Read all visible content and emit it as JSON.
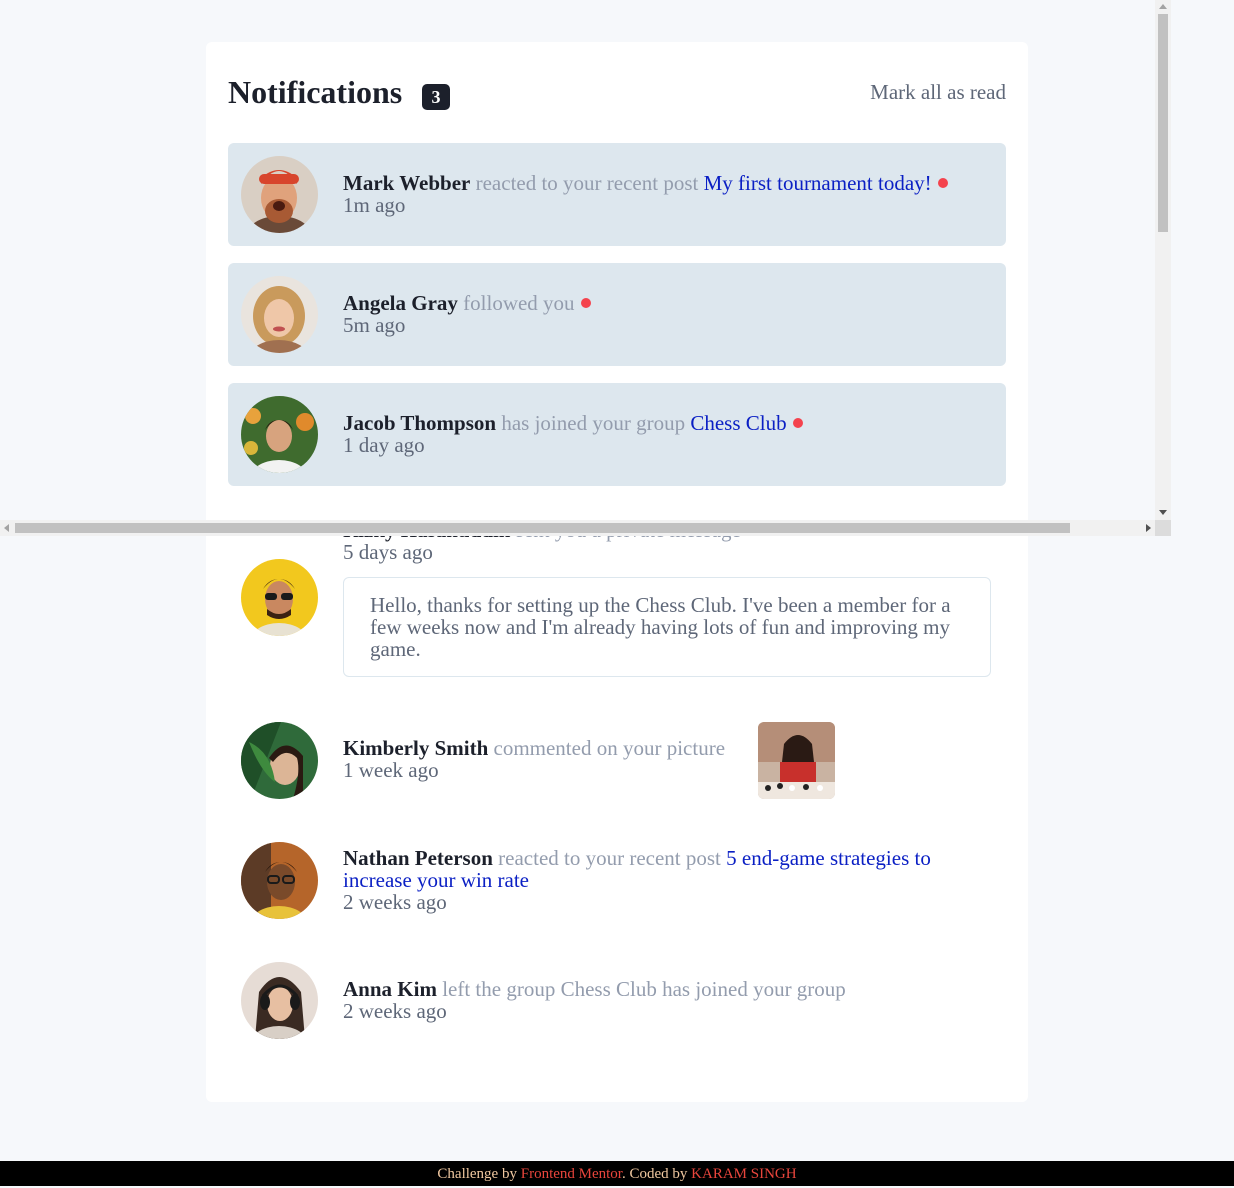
{
  "header": {
    "title": "Notifications",
    "unread_count": "3",
    "mark_all_label": "Mark all as read"
  },
  "notifications": [
    {
      "name": "Mark Webber",
      "action": "reacted to your recent post",
      "target": "My first tournament today!",
      "time": "1m ago",
      "unread": true
    },
    {
      "name": "Angela Gray",
      "action": "followed you",
      "target": "",
      "time": "5m ago",
      "unread": true
    },
    {
      "name": "Jacob Thompson",
      "action": "has joined your group",
      "target": "Chess Club",
      "time": "1 day ago",
      "unread": true
    },
    {
      "name": "Rizky Hasanuddin",
      "action": "sent you a private message",
      "target": "",
      "time": "5 days ago",
      "unread": false,
      "message": "Hello, thanks for setting up the Chess Club. I've been a member for a few weeks now and I'm already having lots of fun and improving my game."
    },
    {
      "name": "Kimberly Smith",
      "action": "commented on your picture",
      "target": "",
      "time": "1 week ago",
      "unread": false
    },
    {
      "name": "Nathan Peterson",
      "action": "reacted to your recent post",
      "target": "5 end-game strategies to increase your win rate",
      "time": "2 weeks ago",
      "unread": false
    },
    {
      "name": "Anna Kim",
      "action": "left the group Chess Club has joined your group",
      "target": "",
      "time": "2 weeks ago",
      "unread": false
    }
  ],
  "footer": {
    "challenge_by": "Challenge by",
    "frontend_mentor": "Frontend Mentor",
    "coded_by": ". Coded by",
    "author": "KARAM SINGH"
  },
  "colors": {
    "unread_bg": "#dde7ee",
    "dot": "#f4434d",
    "link": "#0a1fc4",
    "dark": "#1c202b"
  }
}
